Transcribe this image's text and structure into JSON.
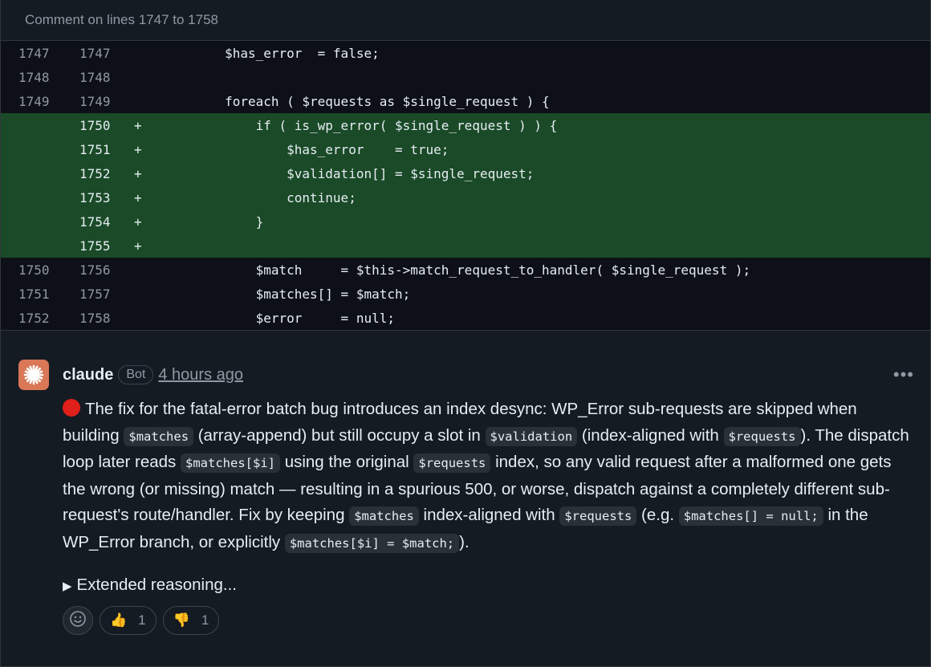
{
  "header": {
    "title": "Comment on lines 1747 to 1758"
  },
  "diff": {
    "rows": [
      {
        "old": "1747",
        "new": "1747",
        "sign": "",
        "code": "        $has_error  = false;",
        "added": false
      },
      {
        "old": "1748",
        "new": "1748",
        "sign": "",
        "code": "",
        "added": false
      },
      {
        "old": "1749",
        "new": "1749",
        "sign": "",
        "code": "        foreach ( $requests as $single_request ) {",
        "added": false
      },
      {
        "old": "",
        "new": "1750",
        "sign": "+",
        "code": "            if ( is_wp_error( $single_request ) ) {",
        "added": true
      },
      {
        "old": "",
        "new": "1751",
        "sign": "+",
        "code": "                $has_error    = true;",
        "added": true
      },
      {
        "old": "",
        "new": "1752",
        "sign": "+",
        "code": "                $validation[] = $single_request;",
        "added": true
      },
      {
        "old": "",
        "new": "1753",
        "sign": "+",
        "code": "                continue;",
        "added": true
      },
      {
        "old": "",
        "new": "1754",
        "sign": "+",
        "code": "            }",
        "added": true
      },
      {
        "old": "",
        "new": "1755",
        "sign": "+",
        "code": "",
        "added": true
      },
      {
        "old": "1750",
        "new": "1756",
        "sign": "",
        "code": "            $match     = $this->match_request_to_handler( $single_request );",
        "added": false
      },
      {
        "old": "1751",
        "new": "1757",
        "sign": "",
        "code": "            $matches[] = $match;",
        "added": false
      },
      {
        "old": "1752",
        "new": "1758",
        "sign": "",
        "code": "            $error     = null;",
        "added": false
      }
    ]
  },
  "comment": {
    "author": "claude",
    "badge": "Bot",
    "time": "4 hours ago",
    "more_icon": "kebab-horizontal-icon",
    "status_color": "#e0201b",
    "parts": [
      {
        "t": "text",
        "v": "The fix for the fatal-error batch bug introduces an index desync: WP_Error sub-requests are skipped when building "
      },
      {
        "t": "code",
        "v": "$matches"
      },
      {
        "t": "text",
        "v": " (array-append) but still occupy a slot in "
      },
      {
        "t": "code",
        "v": "$validation"
      },
      {
        "t": "text",
        "v": " (index-aligned with "
      },
      {
        "t": "code",
        "v": "$requests"
      },
      {
        "t": "text",
        "v": "). The dispatch loop later reads "
      },
      {
        "t": "code",
        "v": "$matches[$i]"
      },
      {
        "t": "text",
        "v": " using the original "
      },
      {
        "t": "code",
        "v": "$requests"
      },
      {
        "t": "text",
        "v": " index, so any valid request after a malformed one gets the wrong (or missing) match — resulting in a spurious 500, or worse, dispatch against a completely different sub-request's route/handler. Fix by keeping "
      },
      {
        "t": "code",
        "v": "$matches"
      },
      {
        "t": "text",
        "v": " index-aligned with "
      },
      {
        "t": "code",
        "v": "$requests"
      },
      {
        "t": "text",
        "v": " (e.g. "
      },
      {
        "t": "code",
        "v": "$matches[] = null;"
      },
      {
        "t": "text",
        "v": " in the WP_Error branch, or explicitly "
      },
      {
        "t": "code",
        "v": "$matches[$i] = $match;"
      },
      {
        "t": "text",
        "v": ")."
      }
    ],
    "reasoning_label": "Extended reasoning...",
    "reactions": [
      {
        "icon": "smiley-icon",
        "emoji": "",
        "count": ""
      },
      {
        "icon": "thumbs-up-icon",
        "emoji": "👍",
        "count": "1"
      },
      {
        "icon": "thumbs-down-icon",
        "emoji": "👎",
        "count": "1"
      }
    ]
  }
}
